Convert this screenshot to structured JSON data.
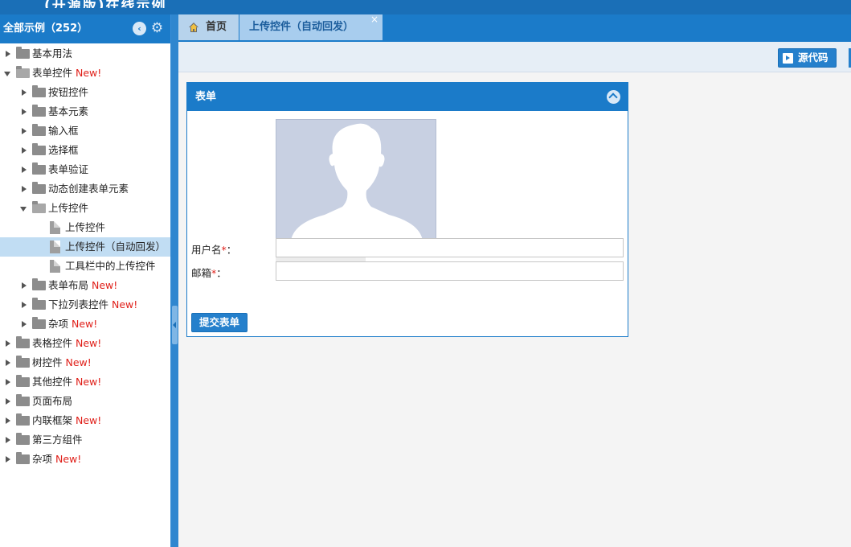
{
  "header": {
    "clipped_title": "(开源版)在线示例"
  },
  "sidebar": {
    "title": "全部示例（252）",
    "new_badge": "New!",
    "items": [
      {
        "label": "基本用法",
        "level": 0,
        "type": "folder",
        "state": "collapsed",
        "new": false
      },
      {
        "label": "表单控件",
        "level": 0,
        "type": "folder",
        "state": "expanded",
        "new": true
      },
      {
        "label": "按钮控件",
        "level": 1,
        "type": "folder",
        "state": "collapsed",
        "new": false
      },
      {
        "label": "基本元素",
        "level": 1,
        "type": "folder",
        "state": "collapsed",
        "new": false
      },
      {
        "label": "输入框",
        "level": 1,
        "type": "folder",
        "state": "collapsed",
        "new": false
      },
      {
        "label": "选择框",
        "level": 1,
        "type": "folder",
        "state": "collapsed",
        "new": false
      },
      {
        "label": "表单验证",
        "level": 1,
        "type": "folder",
        "state": "collapsed",
        "new": false
      },
      {
        "label": "动态创建表单元素",
        "level": 1,
        "type": "folder",
        "state": "collapsed",
        "new": false
      },
      {
        "label": "上传控件",
        "level": 1,
        "type": "folder",
        "state": "expanded",
        "new": false
      },
      {
        "label": "上传控件",
        "level": 2,
        "type": "file",
        "state": "leaf",
        "new": false
      },
      {
        "label": "上传控件（自动回发）",
        "level": 2,
        "type": "file",
        "state": "selected",
        "new": false
      },
      {
        "label": "工具栏中的上传控件",
        "level": 2,
        "type": "file",
        "state": "leaf",
        "new": false
      },
      {
        "label": "表单布局",
        "level": 1,
        "type": "folder",
        "state": "collapsed",
        "new": true
      },
      {
        "label": "下拉列表控件",
        "level": 1,
        "type": "folder",
        "state": "collapsed",
        "new": true
      },
      {
        "label": "杂项",
        "level": 1,
        "type": "folder",
        "state": "collapsed",
        "new": true
      },
      {
        "label": "表格控件",
        "level": 0,
        "type": "folder",
        "state": "collapsed",
        "new": true
      },
      {
        "label": "树控件",
        "level": 0,
        "type": "folder",
        "state": "collapsed",
        "new": true
      },
      {
        "label": "其他控件",
        "level": 0,
        "type": "folder",
        "state": "collapsed",
        "new": true
      },
      {
        "label": "页面布局",
        "level": 0,
        "type": "folder",
        "state": "collapsed",
        "new": false
      },
      {
        "label": "内联框架",
        "level": 0,
        "type": "folder",
        "state": "collapsed",
        "new": true
      },
      {
        "label": "第三方组件",
        "level": 0,
        "type": "folder",
        "state": "collapsed",
        "new": false
      },
      {
        "label": "杂项",
        "level": 0,
        "type": "folder",
        "state": "collapsed",
        "new": true
      }
    ]
  },
  "tabs": [
    {
      "label": "首页",
      "icon": "home-icon"
    },
    {
      "label": "上传控件（自动回发）",
      "close": "×"
    }
  ],
  "toolbar": {
    "source_label": "源代码"
  },
  "panel": {
    "title": "表单",
    "username_label": "用户名",
    "email_label": "邮箱",
    "required_mark": "*",
    "colon": "：",
    "username_value": "",
    "email_value": "",
    "submit_label": "提交表单"
  },
  "colors": {
    "accent": "#1b7bc9",
    "selected": "#c1ddf3",
    "new_badge": "#e0201a"
  }
}
